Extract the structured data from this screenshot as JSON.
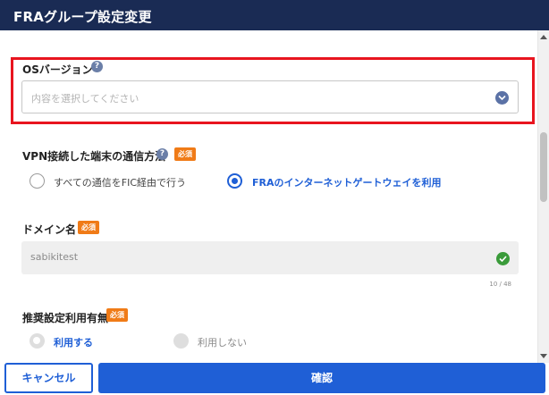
{
  "dialog": {
    "title": "FRAグループ設定変更"
  },
  "os_version": {
    "label": "OSバージョン",
    "help": "?",
    "placeholder": "内容を選択してください"
  },
  "vpn_method": {
    "label": "VPN接続した端末の通信方法",
    "help": "?",
    "required": "必須",
    "options": [
      {
        "label": "すべての通信をFIC経由で行う",
        "checked": false
      },
      {
        "label": "FRAのインターネットゲートウェイを利用",
        "checked": true
      }
    ]
  },
  "domain": {
    "label": "ドメイン名",
    "required": "必須",
    "value": "sabikitest",
    "count": "10 / 48"
  },
  "recommended": {
    "label": "推奨設定利用有無",
    "required": "必須",
    "options": [
      {
        "label": "利用する",
        "checked": true,
        "disabled": true
      },
      {
        "label": "利用しない",
        "checked": false,
        "disabled": true
      }
    ]
  },
  "footer": {
    "cancel": "キャンセル",
    "confirm": "確認"
  },
  "colors": {
    "header": "#1a2b54",
    "primary": "#1f5fd6",
    "required": "#f07b17",
    "highlight": "#e8151f"
  },
  "icons": [
    "help-icon",
    "chevron-down-icon",
    "check-icon"
  ]
}
